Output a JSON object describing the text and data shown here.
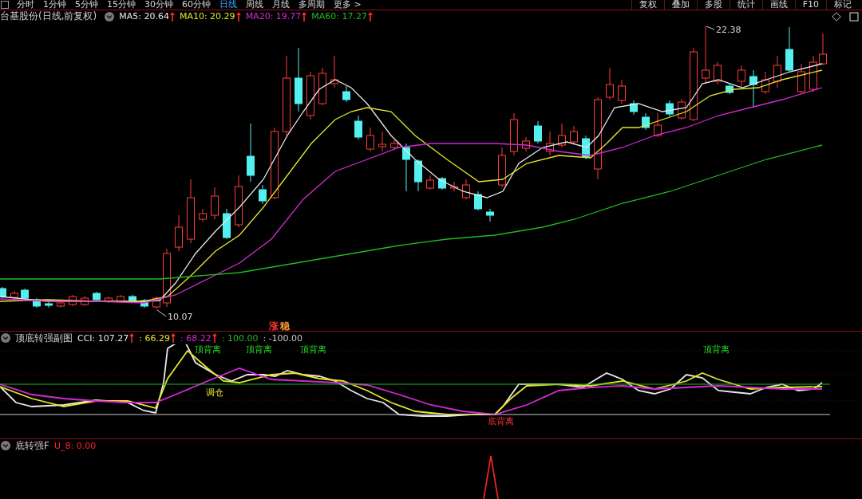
{
  "toolbar": {
    "periods": [
      {
        "label": "分时",
        "selected": false
      },
      {
        "label": "1分钟",
        "selected": false
      },
      {
        "label": "5分钟",
        "selected": false
      },
      {
        "label": "15分钟",
        "selected": false
      },
      {
        "label": "30分钟",
        "selected": false
      },
      {
        "label": "60分钟",
        "selected": false
      },
      {
        "label": "日线",
        "selected": true
      },
      {
        "label": "周线",
        "selected": false
      },
      {
        "label": "月线",
        "selected": false
      },
      {
        "label": "多周期",
        "selected": false
      },
      {
        "label": "更多 >",
        "selected": false
      }
    ],
    "tools": [
      "复权",
      "叠加",
      "多股",
      "统计",
      "画线",
      "F10",
      "标记"
    ]
  },
  "main_chart": {
    "title": "台基股份(日线,前复权)",
    "indicators": [
      {
        "label": "MA5: 20.64",
        "color": "#e8e8e8",
        "rising": true
      },
      {
        "label": "MA10: 20.29",
        "color": "#e6e62a",
        "rising": true
      },
      {
        "label": "MA20: 19.77",
        "color": "#d42ad4",
        "rising": true
      },
      {
        "label": "MA60: 17.27",
        "color": "#22b822",
        "rising": true
      }
    ],
    "high_label": "22.38",
    "low_label": "10.07",
    "signals": [
      {
        "text": "涨",
        "color": "#ff2e2e"
      },
      {
        "text": "稳",
        "color": "#ff9a30"
      }
    ]
  },
  "sub_chart": {
    "title": "顶底转强副图",
    "values": [
      {
        "label": "CCI: 107.27",
        "color": "#e8e8e8",
        "rising": true
      },
      {
        "label": ": 66.29",
        "color": "#e6e62a",
        "rising": true
      },
      {
        "label": ": 68.22",
        "color": "#d42ad4",
        "rising": true
      },
      {
        "label": ": 100.00",
        "color": "#22b822",
        "rising": false
      },
      {
        "label": ": -100.00",
        "color": "#c8c8c8",
        "rising": false
      }
    ],
    "signals": [
      {
        "text": "顶背离",
        "kind": "top"
      },
      {
        "text": "顶背离",
        "kind": "top"
      },
      {
        "text": "顶背离",
        "kind": "top"
      },
      {
        "text": "顶背离",
        "kind": "top"
      },
      {
        "text": "底背离",
        "kind": "bottom"
      },
      {
        "text": "调仓",
        "kind": "cross"
      }
    ]
  },
  "bottom_chart": {
    "title": "底转强F",
    "values": [
      {
        "label": "U_8: 0.00",
        "color": "#ff2424",
        "rising": false
      }
    ]
  }
}
